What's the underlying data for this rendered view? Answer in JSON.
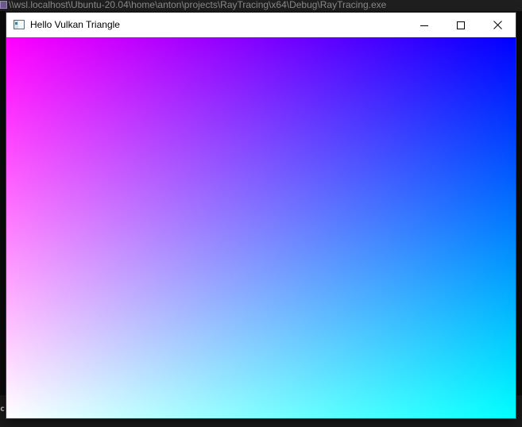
{
  "console": {
    "title": "\\\\wsl.localhost\\Ubuntu-20.04\\home\\anton\\projects\\RayTracing\\x64\\Debug\\RayTracing.exe",
    "visible_char": "c"
  },
  "app_window": {
    "title": "Hello Vulkan Triangle",
    "caption_buttons": {
      "minimize": "minimize",
      "maximize": "maximize",
      "close": "close"
    },
    "render": {
      "corner_colors": {
        "top_left": "#ff00ff",
        "top_right": "#0000ff",
        "bottom_left": "#ffffff",
        "bottom_right": "#00ffff"
      }
    }
  },
  "colors": {
    "console_bg": "#0c0c0c",
    "titlebar_bg": "#ffffff"
  }
}
